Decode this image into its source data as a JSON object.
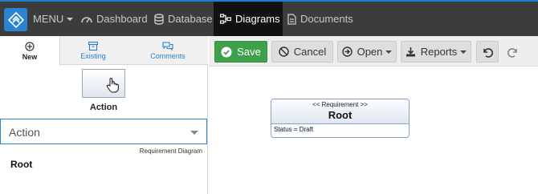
{
  "nav": {
    "menu_label": "MENU",
    "items": [
      {
        "label": "Dashboard"
      },
      {
        "label": "Database"
      },
      {
        "label": "Diagrams"
      },
      {
        "label": "Documents"
      }
    ]
  },
  "left_panel": {
    "tabs": [
      {
        "label": "New",
        "icon": "plus-circle-icon",
        "active": true
      },
      {
        "label": "Existing",
        "icon": "archive-icon",
        "active": false
      },
      {
        "label": "Comments",
        "icon": "comments-icon",
        "active": false
      }
    ],
    "action_label": "Action",
    "select_value": "Action",
    "diagram_type": "Requirement Diagram",
    "root_label": "Root"
  },
  "toolbar": {
    "save": "Save",
    "cancel": "Cancel",
    "open": "Open",
    "reports": "Reports"
  },
  "canvas": {
    "requirement": {
      "stereotype": "<< Requirement >>",
      "name": "Root",
      "status": "Status = Draft"
    }
  },
  "colors": {
    "nav_bg": "#3c3c3c",
    "accent": "#2a84d2",
    "save_green": "#3ea04b"
  }
}
